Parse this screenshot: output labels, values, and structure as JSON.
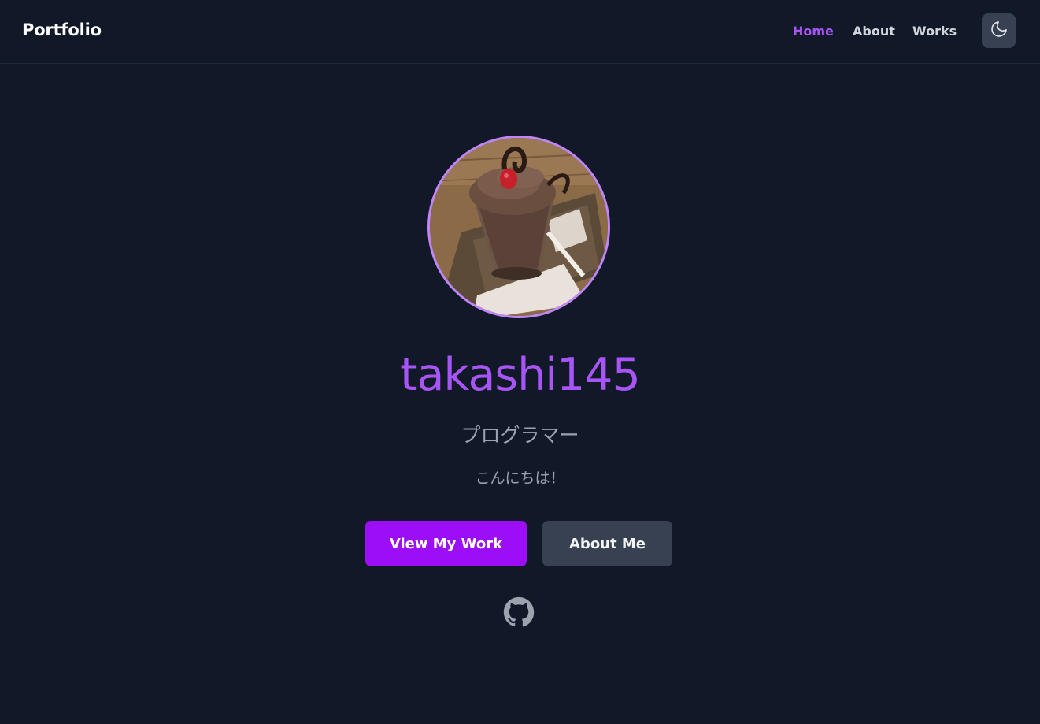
{
  "header": {
    "brand": "Portfolio",
    "nav": [
      {
        "label": "Home",
        "active": true
      },
      {
        "label": "About",
        "active": false
      },
      {
        "label": "Works",
        "active": false
      }
    ],
    "theme_toggle_icon": "moon-icon"
  },
  "hero": {
    "avatar_alt": "profile-photo",
    "name": "takashi145",
    "role": "プログラマー",
    "greeting": "こんにちは！",
    "primary_button": "View My Work",
    "secondary_button": "About Me",
    "social_icon": "github-icon"
  },
  "colors": {
    "background": "#111827",
    "accent": "#a855f7",
    "primary_button": "#9c0ef7",
    "secondary_button": "#374151",
    "muted_text": "#9ca3af"
  }
}
